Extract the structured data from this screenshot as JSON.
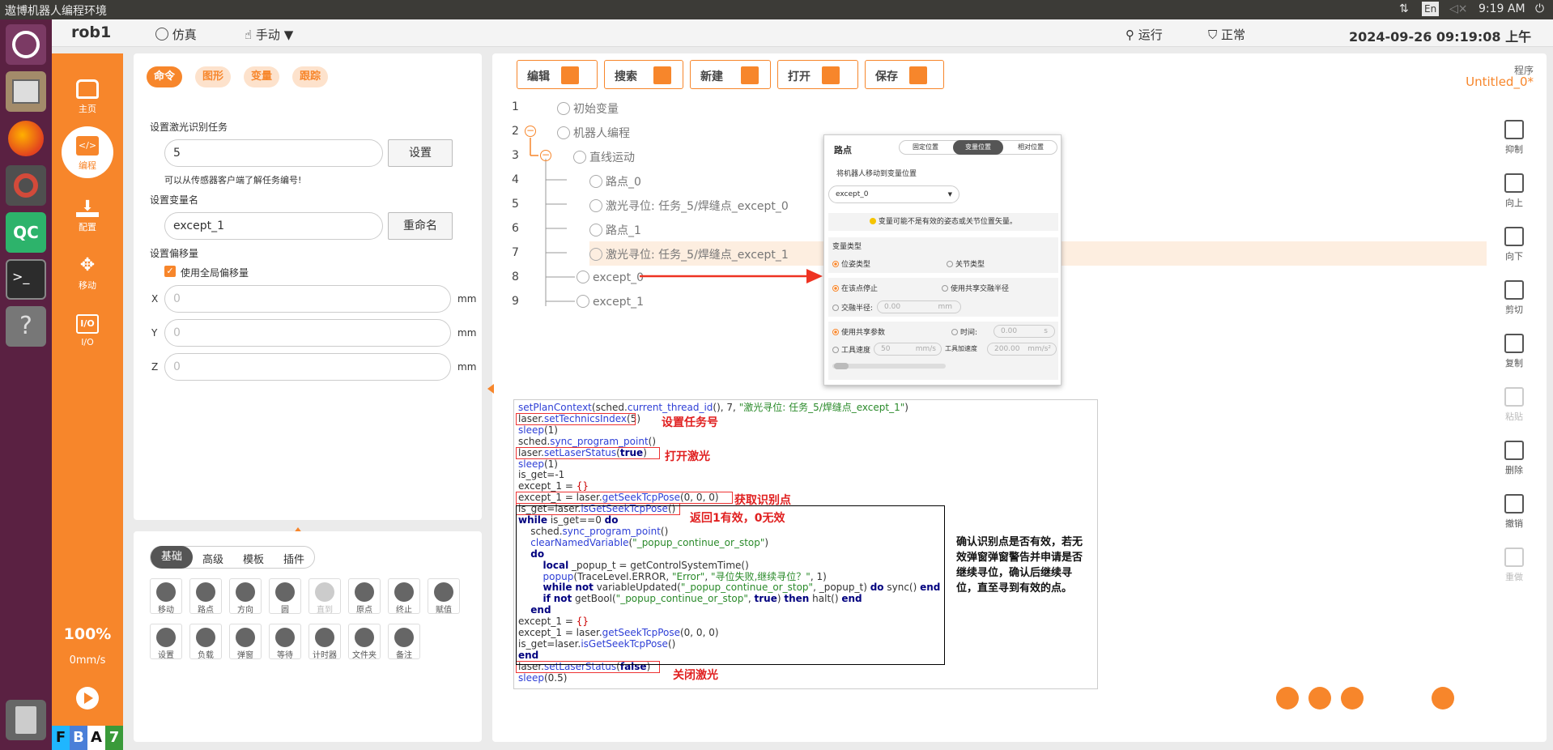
{
  "os": {
    "title": "遨博机器人编程环境",
    "lang": "En",
    "time": "9:19 AM"
  },
  "header": {
    "robot": "rob1",
    "sim": "仿真",
    "mode": "手动",
    "run": "运行",
    "status": "正常",
    "datetime": "2024-09-26 09:19:08 上午"
  },
  "launcher": {
    "fbat": [
      "F",
      "B",
      "A",
      "7"
    ]
  },
  "nav": [
    {
      "label": "主页",
      "icon": "home-icon"
    },
    {
      "label": "编程",
      "icon": "code-icon"
    },
    {
      "label": "配置",
      "icon": "config-icon"
    },
    {
      "label": "移动",
      "icon": "move-icon"
    },
    {
      "label": "I/O",
      "icon": "io-icon"
    }
  ],
  "speed": {
    "percent": "100%",
    "velocity": "0mm/s"
  },
  "left": {
    "tabs": [
      "命令",
      "图形",
      "变量",
      "跟踪"
    ],
    "task_label": "设置激光识别任务",
    "task_value": "5",
    "task_button": "设置",
    "task_hint": "可以从传感器客户端了解任务编号!",
    "var_label": "设置变量名",
    "var_value": "except_1",
    "var_button": "重命名",
    "offset_label": "设置偏移量",
    "global_offset": "使用全局偏移量",
    "axes": [
      {
        "axis": "X",
        "placeholder": "0",
        "unit": "mm"
      },
      {
        "axis": "Y",
        "placeholder": "0",
        "unit": "mm"
      },
      {
        "axis": "Z",
        "placeholder": "0",
        "unit": "mm"
      }
    ]
  },
  "cmd": {
    "tabs": [
      "基础",
      "高级",
      "模板",
      "插件"
    ],
    "row1": [
      {
        "label": "移动",
        "icon": "move-icon"
      },
      {
        "label": "路点",
        "icon": "waypoint-icon"
      },
      {
        "label": "方向",
        "icon": "direction-icon"
      },
      {
        "label": "圆",
        "icon": "circle-icon"
      },
      {
        "label": "直到",
        "icon": "until-icon"
      },
      {
        "label": "原点",
        "icon": "origin-icon"
      },
      {
        "label": "终止",
        "icon": "stop-icon"
      },
      {
        "label": "赋值",
        "icon": "assign-icon"
      }
    ],
    "row2": [
      {
        "label": "设置",
        "icon": "settings-icon"
      },
      {
        "label": "负载",
        "icon": "payload-icon"
      },
      {
        "label": "弹窗",
        "icon": "popup-icon"
      },
      {
        "label": "等待",
        "icon": "wait-icon"
      },
      {
        "label": "计时器",
        "icon": "timer-icon"
      },
      {
        "label": "文件夹",
        "icon": "folder-icon"
      },
      {
        "label": "备注",
        "icon": "comment-icon"
      }
    ]
  },
  "toolbar": [
    "编辑",
    "搜索",
    "新建",
    "打开",
    "保存"
  ],
  "program": {
    "label": "程序",
    "name": "Untitled_0*"
  },
  "tree": [
    {
      "n": "1",
      "text": "初始变量"
    },
    {
      "n": "2",
      "text": "机器人编程"
    },
    {
      "n": "3",
      "text": "直线运动"
    },
    {
      "n": "4",
      "text": "路点_0"
    },
    {
      "n": "5",
      "text": "激光寻位: 任务_5/焊缝点_except_0"
    },
    {
      "n": "6",
      "text": "路点_1"
    },
    {
      "n": "7",
      "text": "激光寻位: 任务_5/焊缝点_except_1"
    },
    {
      "n": "8",
      "text": "except_0"
    },
    {
      "n": "9",
      "text": "except_1"
    }
  ],
  "popup": {
    "title": "路点",
    "tabs": [
      "固定位置",
      "变量位置",
      "相对位置"
    ],
    "subtitle": "将机器人移动到变量位置",
    "select": "except_0",
    "warning": "变量可能不是有效的姿态或关节位置矢量。",
    "vartype": "变量类型",
    "pose": "位姿类型",
    "joint": "关节类型",
    "stop": "在该点停止",
    "shared_radius": "使用共享交融半径",
    "blend": "交融半径:",
    "blend_val": "0.00",
    "blend_unit": "mm",
    "shared_params": "使用共享参数",
    "time": "时间:",
    "time_val": "0.00",
    "time_unit": "s",
    "tool_speed": "工具速度",
    "speed_val": "50",
    "speed_unit": "mm/s",
    "tool_acc": "工具加速度",
    "acc_val": "200.00",
    "acc_unit": "mm/s²"
  },
  "code": {
    "lines": [
      "setPlanContext(sched.current_thread_id(), 7, \"激光寻位: 任务_5/焊缝点_except_1\")",
      "laser.setTechnicsIndex(5)",
      "sleep(1)",
      "sched.sync_program_point()",
      "laser.setLaserStatus(true)",
      "sleep(1)",
      "is_get=-1",
      "except_1 = {}",
      "except_1 = laser.getSeekTcpPose(0, 0, 0)",
      "is_get=laser.isGetSeekTcpPose()",
      "while is_get==0 do",
      "    sched.sync_program_point()",
      "    clearNamedVariable(\"_popup_continue_or_stop\")",
      "    do",
      "        local _popup_t = getControlSystemTime()",
      "        popup(TraceLevel.ERROR, \"Error\", \"寻位失败,继续寻位？\", 1)",
      "        while not variableUpdated(\"_popup_continue_or_stop\", _popup_t) do sync() end",
      "        if not getBool(\"_popup_continue_or_stop\", true) then halt() end",
      "    end",
      "except_1 = {}",
      "except_1 = laser.getSeekTcpPose(0, 0, 0)",
      "is_get=laser.isGetSeekTcpPose()",
      "end",
      "laser.setLaserStatus(false)",
      "sleep(0.5)"
    ],
    "annotations": {
      "task": "设置任务号",
      "laser_on": "打开激光",
      "get_point": "获取识别点",
      "valid": "返回1有效，0无效",
      "laser_off": "关闭激光",
      "confirm": "确认识别点是否有效，若无效弹窗弹窗警告并申请是否继续寻位，确认后继续寻位，直至寻到有效的点。"
    }
  },
  "right_tools": [
    {
      "label": "抑制",
      "icon": "suppress-icon"
    },
    {
      "label": "向上",
      "icon": "arrow-up-icon"
    },
    {
      "label": "向下",
      "icon": "arrow-down-icon"
    },
    {
      "label": "剪切",
      "icon": "scissors-icon"
    },
    {
      "label": "复制",
      "icon": "copy-icon"
    },
    {
      "label": "粘贴",
      "icon": "paste-icon"
    },
    {
      "label": "删除",
      "icon": "trash-icon"
    },
    {
      "label": "撤销",
      "icon": "undo-icon"
    },
    {
      "label": "重做",
      "icon": "redo-icon"
    }
  ]
}
